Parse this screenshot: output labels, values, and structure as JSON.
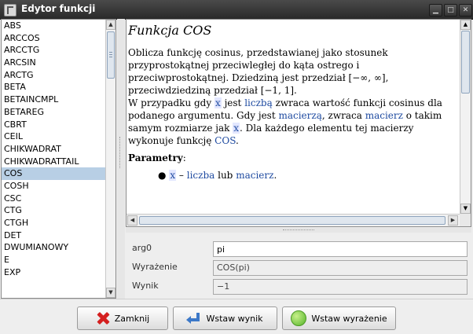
{
  "window": {
    "title": "Edytor funkcji"
  },
  "functions": {
    "items": [
      "ABS",
      "ARCCOS",
      "ARCCTG",
      "ARCSIN",
      "ARCTG",
      "BETA",
      "BETAINCMPL",
      "BETAREG",
      "CBRT",
      "CEIL",
      "CHIKWADRAT",
      "CHIKWADRATTAIL",
      "COS",
      "COSH",
      "CSC",
      "CTG",
      "CTGH",
      "DET",
      "DWUMIANOWY",
      "E",
      "EXP"
    ],
    "selected": "COS"
  },
  "doc": {
    "title": "Funkcja COS",
    "p1": "Oblicza funkcję cosinus, przedstawianej jako stosunek przyprostokątnej przeciwległej do kąta ostrego i przeciwprostokątnej. Dziedziną jest przedział [−∞, ∞], przeciwdziedziną przedział [−1, 1].",
    "p2a": "W przypadku gdy ",
    "p2x1": "x",
    "p2b": " jest ",
    "p2liczba": "liczbą",
    "p2c": " zwraca wartość funkcji cosinus dla podanego argumentu. Gdy jest ",
    "p2macierza": "macierzą",
    "p2d": ", zwraca ",
    "p2macierz": "macierz",
    "p2e": " o takim samym rozmiarze jak ",
    "p2x2": "x",
    "p2f": ". Dla każdego elementu tej macierzy wykonuje funkcję ",
    "p2cos": "COS",
    "p2g": ".",
    "params_label": "Parametry",
    "params_colon": ":",
    "bullet_x": "x",
    "bullet_dash": " – ",
    "bullet_liczba": "liczba",
    "bullet_lub": " lub ",
    "bullet_macierz": "macierz",
    "bullet_end": "."
  },
  "form": {
    "arg_label": "arg0",
    "arg_value": "pi",
    "expr_label": "Wyrażenie",
    "expr_value": "COS(pi)",
    "result_label": "Wynik",
    "result_value": "−1"
  },
  "buttons": {
    "close": "Zamknij",
    "insert_result": "Wstaw wynik",
    "insert_expression": "Wstaw wyrażenie"
  },
  "colors": {
    "link": "#1e4aa0",
    "selection": "#b8cfe5",
    "close_icon": "#d41f1f"
  }
}
